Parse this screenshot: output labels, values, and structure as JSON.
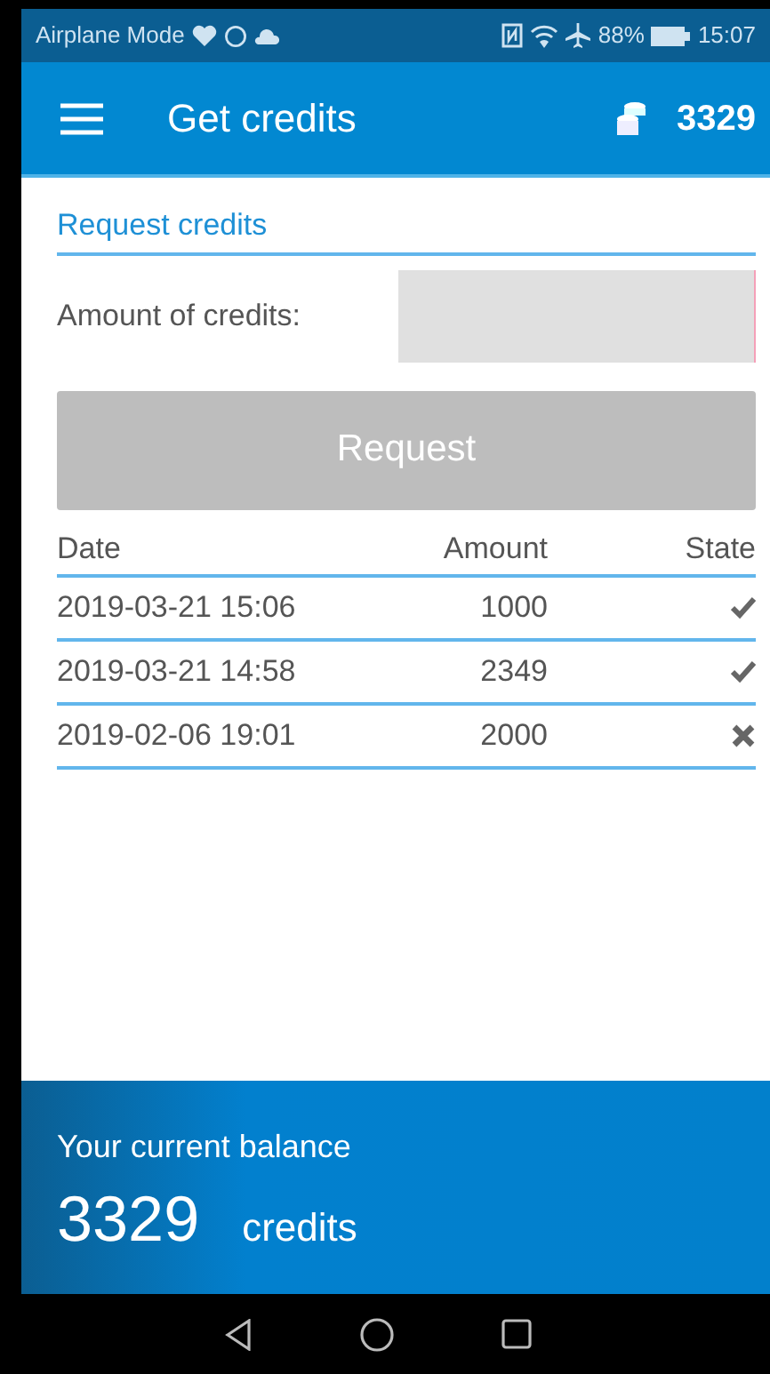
{
  "status_bar": {
    "carrier": "Airplane Mode",
    "battery": "88%",
    "time": "15:07"
  },
  "app_bar": {
    "title": "Get credits",
    "credits": "3329"
  },
  "request_form": {
    "heading": "Request credits",
    "amount_label": "Amount of credits:",
    "button": {
      "label": "Request",
      "disabled": true
    }
  },
  "table": {
    "columns": [
      "Date",
      "Amount",
      "State"
    ],
    "rows": [
      {
        "date": "2019-03-21 15:06",
        "amount": "1000",
        "accepted": true
      },
      {
        "date": "2019-03-21 14:58",
        "amount": "2349",
        "accepted": true
      },
      {
        "date": "2019-02-06 19:01",
        "amount": "2000",
        "accepted": false
      }
    ]
  },
  "balance": {
    "label": "Your current balance",
    "value": "3329",
    "unit": "credits"
  }
}
